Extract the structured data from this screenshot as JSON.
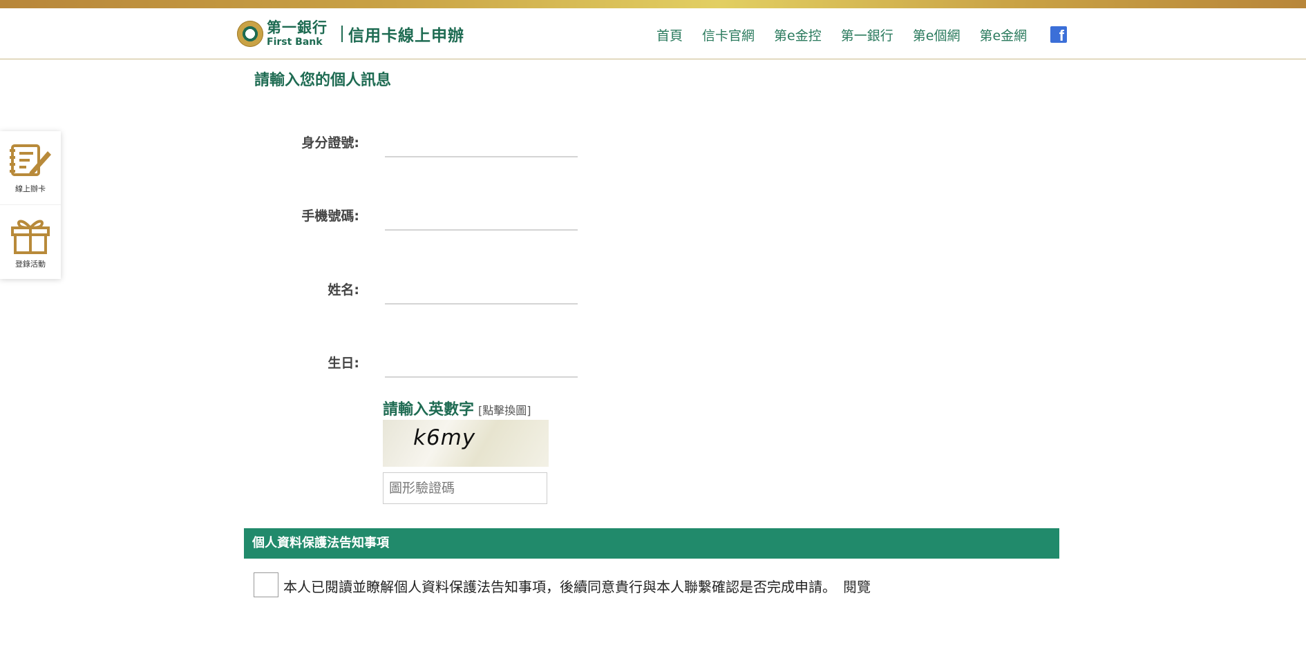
{
  "header": {
    "logo_cn": "第一銀行",
    "logo_en": "First Bank",
    "subtitle": "信用卡線上申辦",
    "nav": [
      "首頁",
      "信卡官網",
      "第e金控",
      "第一銀行",
      "第e個網",
      "第e金網"
    ],
    "facebook_icon": "facebook-icon"
  },
  "sidebar": {
    "items": [
      {
        "label": "線上辦卡",
        "icon": "notepad-pen-icon"
      },
      {
        "label": "登錄活動",
        "icon": "gift-icon"
      }
    ]
  },
  "form": {
    "title": "請輸入您的個人訊息",
    "fields": [
      {
        "label": "身分證號:",
        "value": ""
      },
      {
        "label": "手機號碼:",
        "value": ""
      },
      {
        "label": "姓名:",
        "value": ""
      },
      {
        "label": "生日:",
        "value": ""
      }
    ]
  },
  "captcha": {
    "title": "請輸入英數字",
    "refresh": "[點擊換圖]",
    "image_text": "k6my",
    "placeholder": "圖形驗證碼"
  },
  "notice": {
    "bar_title": "個人資料保護法告知事項",
    "consent_text": "本人已閱讀並瞭解個人資料保護法告知事項，後續同意貴行與本人聯繫確認是否完成申請。",
    "consent_link": "閱覽"
  },
  "colors": {
    "brand_green": "#1e6b52",
    "bar_green": "#218a6b",
    "gold": "#c9a245"
  }
}
